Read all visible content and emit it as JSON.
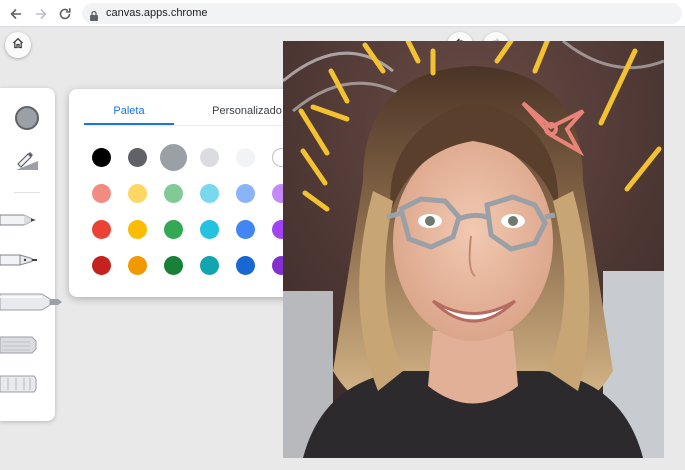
{
  "browser": {
    "url": "canvas.apps.chrome",
    "icons": [
      "back-arrow-icon",
      "forward-arrow-icon",
      "reload-icon",
      "lock-icon"
    ]
  },
  "toolbar": {
    "home_icon": "home-icon",
    "undo_icon": "undo-icon",
    "redo_icon": "redo-icon"
  },
  "tools": {
    "current_color": "#9aa0a6",
    "items": [
      "color-picker",
      "fill-tool",
      "pen",
      "fountain-pen",
      "marker",
      "pencil",
      "chalk"
    ]
  },
  "palette": {
    "tabs": [
      {
        "label": "Paleta",
        "active": true
      },
      {
        "label": "Personalizado",
        "active": false
      }
    ],
    "colors": [
      [
        "#000000",
        "#5f6368",
        "#9aa0a6",
        "#dadce0",
        "#f1f3f4",
        "#ffffff"
      ],
      [
        "#f28b82",
        "#fdd663",
        "#81c995",
        "#78d9ec",
        "#8ab4f8",
        "#c58af9"
      ],
      [
        "#ea4335",
        "#fbbc04",
        "#34a853",
        "#24c1e0",
        "#4285f4",
        "#a142f4"
      ],
      [
        "#c5221f",
        "#f29900",
        "#188038",
        "#12a4af",
        "#1967d2",
        "#8430ce"
      ]
    ],
    "selected_color": "#9aa0a6"
  },
  "canvas": {
    "image": "portrait-photo",
    "drawings": [
      "yellow-strokes",
      "pink-bow",
      "gray-glasses"
    ]
  }
}
